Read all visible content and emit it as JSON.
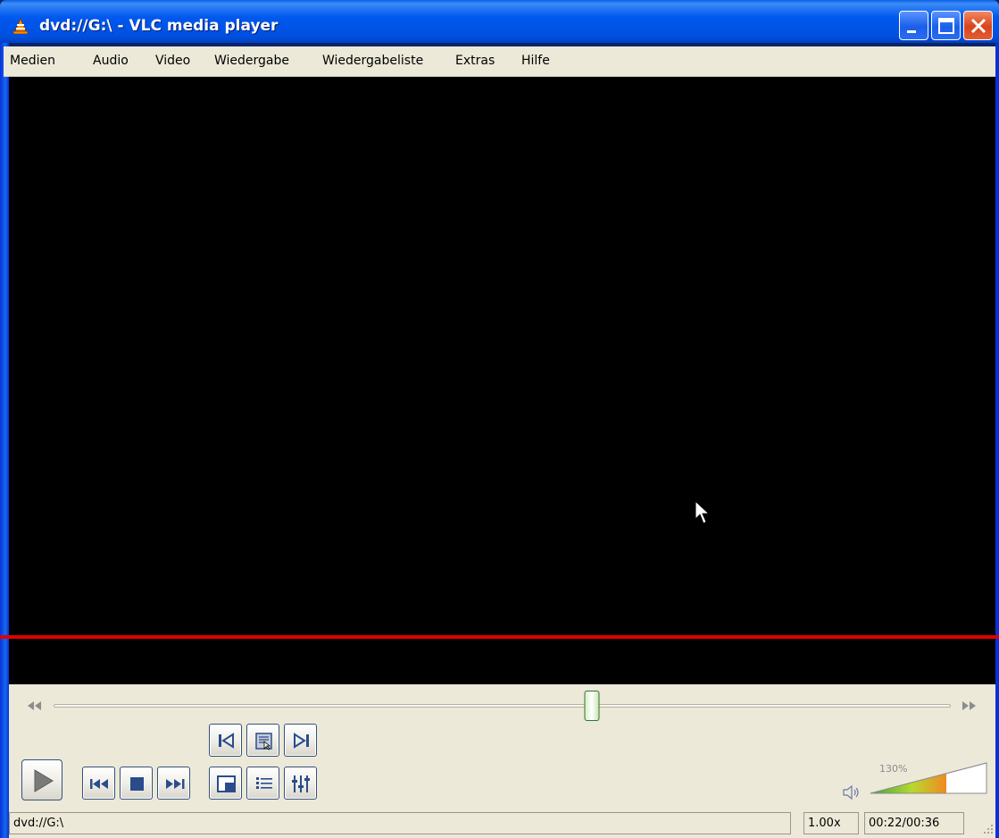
{
  "window": {
    "title": "dvd://G:\\ - VLC media player"
  },
  "menubar": {
    "items": [
      {
        "label": "Medien"
      },
      {
        "label": "Audio"
      },
      {
        "label": "Video"
      },
      {
        "label": "Wiedergabe"
      },
      {
        "label": "Wiedergabeliste"
      },
      {
        "label": "Extras"
      },
      {
        "label": "Hilfe"
      }
    ]
  },
  "seek": {
    "position_fraction": 0.6,
    "back_icon": "seek-back-icon",
    "forward_icon": "seek-forward-icon"
  },
  "controls": {
    "play_icon": "play-icon",
    "prev_icon": "previous-icon",
    "stop_icon": "stop-icon",
    "next_icon": "next-icon",
    "frame_prev_icon": "skip-back-icon",
    "snapshot_icon": "snapshot-icon",
    "frame_next_icon": "skip-forward-icon",
    "fullscreen_icon": "fullscreen-icon",
    "playlist_icon": "playlist-icon",
    "equalizer_icon": "equalizer-icon"
  },
  "volume": {
    "percent_label": "130%",
    "level_fraction": 0.65,
    "accent": "#f0a030"
  },
  "statusbar": {
    "media": "dvd://G:\\",
    "speed": "1.00x",
    "time": "00:22/00:36"
  },
  "colors": {
    "titlebar": "#0058ee",
    "video_bg": "#000000",
    "indicator_line": "#e00000"
  }
}
